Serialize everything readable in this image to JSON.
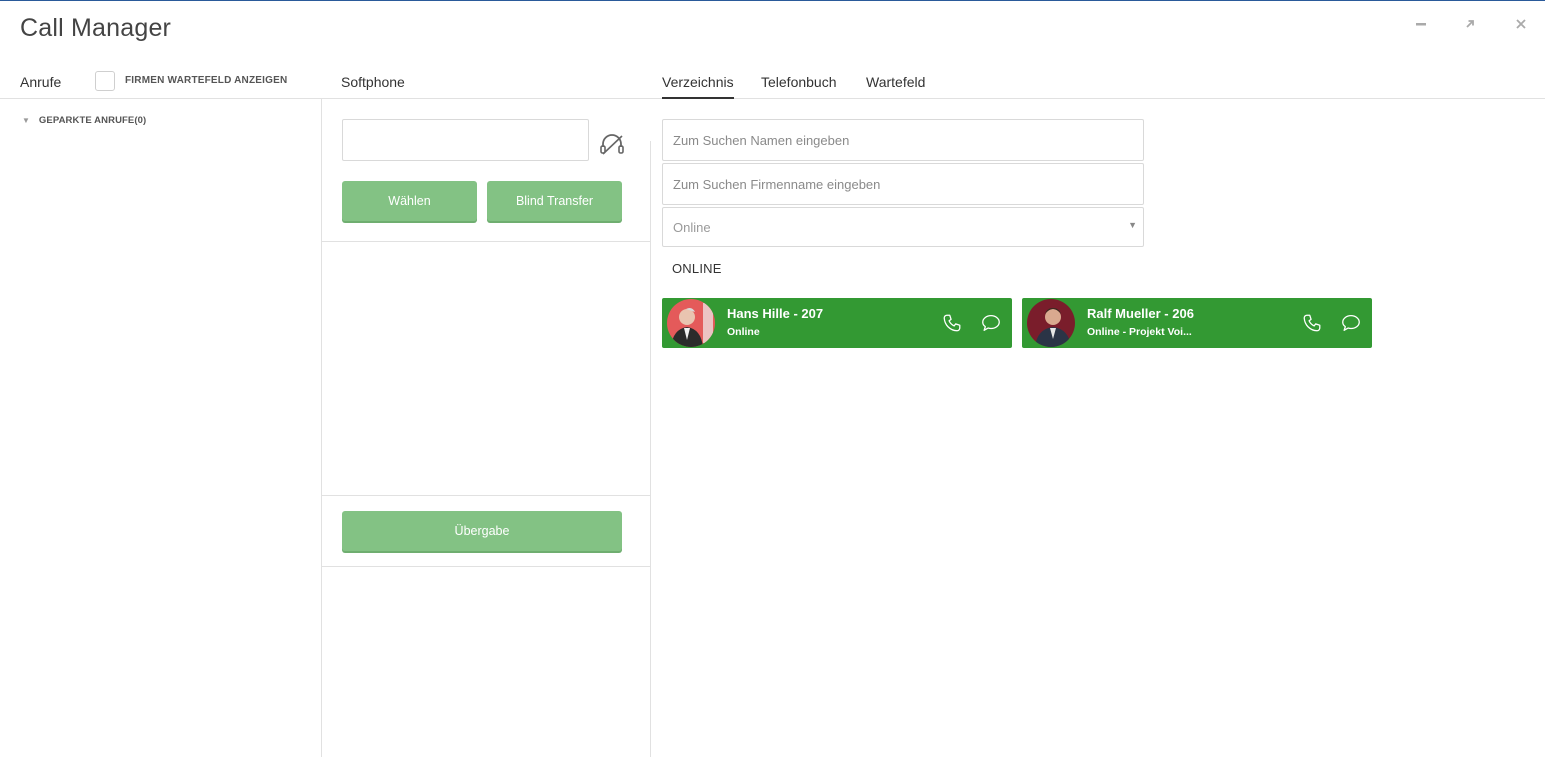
{
  "window": {
    "title": "Call Manager",
    "controls": {
      "minimize": "minimize-icon",
      "maximize": "maximize-icon",
      "close": "close-icon"
    }
  },
  "left": {
    "tab": "Anrufe",
    "checkbox_label": "FIRMEN WARTEFELD ANZEIGEN",
    "checkbox_checked": false,
    "parked": "GEPARKTE ANRUFE(0)"
  },
  "softphone": {
    "tab": "Softphone",
    "dial_value": "",
    "dial_button": "Wählen",
    "blind_transfer_button": "Blind Transfer",
    "transfer_button": "Übergabe"
  },
  "directory": {
    "tabs": [
      {
        "label": "Verzeichnis",
        "active": true
      },
      {
        "label": "Telefonbuch",
        "active": false
      },
      {
        "label": "Wartefeld",
        "active": false
      }
    ],
    "search_name_placeholder": "Zum Suchen Namen eingeben",
    "search_company_placeholder": "Zum Suchen Firmenname eingeben",
    "status_filter": "Online",
    "section_title": "ONLINE",
    "contacts": [
      {
        "name": "Hans Hille - 207",
        "status": "Online"
      },
      {
        "name": "Ralf Mueller - 206",
        "status": "Online - Projekt Voi..."
      }
    ]
  },
  "colors": {
    "card_green": "#339933",
    "button_green": "#83c284",
    "divider": "#e1e1e1"
  }
}
